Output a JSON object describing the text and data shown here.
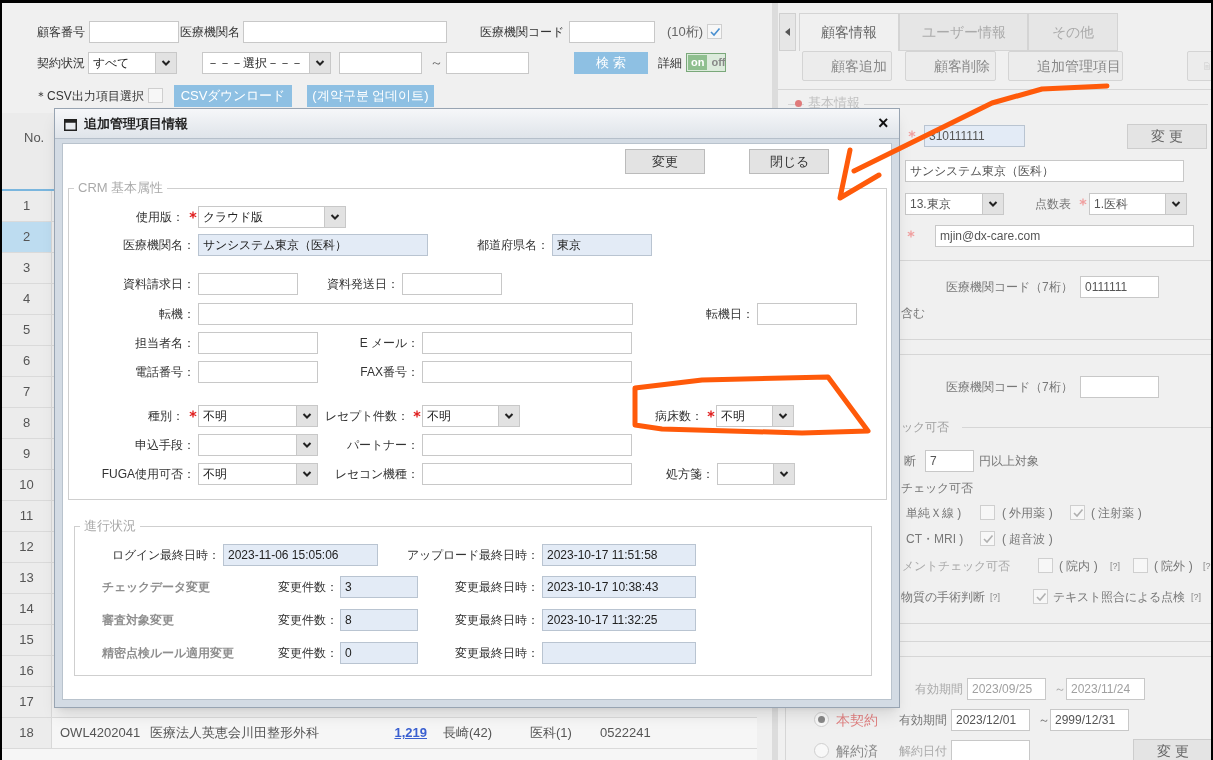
{
  "filter": {
    "rows": [
      {
        "items": [
          {
            "kind": "label",
            "text": "顧客番号"
          },
          {
            "kind": "field"
          },
          {
            "kind": "label",
            "text": "医療機関名"
          },
          {
            "kind": "field"
          },
          {
            "kind": "label",
            "text": "医療機関コード"
          },
          {
            "kind": "field"
          },
          {
            "kind": "note",
            "text": "(10桁)"
          },
          {
            "kind": "checkbox",
            "checked": true
          }
        ]
      },
      {
        "items": [
          {
            "kind": "label",
            "text": "契約状況"
          },
          {
            "kind": "select",
            "value": "すべて"
          },
          {
            "kind": "select",
            "value": "－－－選択－－－"
          },
          {
            "kind": "field"
          },
          {
            "kind": "note",
            "text": "～"
          },
          {
            "kind": "field"
          },
          {
            "kind": "primary_button",
            "text": "検 索"
          },
          {
            "kind": "label",
            "text": "詳細"
          },
          {
            "kind": "toggle",
            "on": true,
            "on_text": "on",
            "off_text": "off"
          }
        ]
      },
      {
        "items": [
          {
            "kind": "label",
            "text": "＊CSV出力項目選択"
          },
          {
            "kind": "checkbox",
            "checked": false
          },
          {
            "kind": "primary_button",
            "text": "CSVダウンロード"
          },
          {
            "kind": "primary_button",
            "text": "(계약구분 업데이트)"
          }
        ]
      }
    ]
  },
  "table": {
    "header": "No.",
    "rows": [
      {
        "no": "1",
        "selected": false
      },
      {
        "no": "2",
        "selected": true
      },
      {
        "no": "3",
        "selected": false
      },
      {
        "no": "4",
        "selected": false
      },
      {
        "no": "5",
        "selected": false
      },
      {
        "no": "6",
        "selected": false
      },
      {
        "no": "7",
        "selected": false
      },
      {
        "no": "8",
        "selected": false
      },
      {
        "no": "9",
        "selected": false
      },
      {
        "no": "10",
        "selected": false
      },
      {
        "no": "11",
        "selected": false
      },
      {
        "no": "12",
        "selected": false
      },
      {
        "no": "13",
        "selected": false
      },
      {
        "no": "14",
        "selected": false
      },
      {
        "no": "15",
        "selected": false
      },
      {
        "no": "16",
        "selected": false
      },
      {
        "no": "17",
        "selected": false
      },
      {
        "no": "18",
        "selected": false,
        "cells": [
          {
            "kind": "text",
            "text": "OWL4202041"
          },
          {
            "kind": "text",
            "text": "医療法人英恵会川田整形外科"
          },
          {
            "kind": "link",
            "text": "1,219"
          },
          {
            "kind": "text",
            "text": "長崎(42)"
          },
          {
            "kind": "text",
            "text": "医科(1)"
          },
          {
            "kind": "text",
            "text": "0522241"
          }
        ]
      }
    ]
  },
  "detail_panel": {
    "tabs": [
      {
        "label": "顧客情報",
        "selected": true
      },
      {
        "label": "ユーザー情報",
        "selected": false
      },
      {
        "label": "その他",
        "selected": false
      }
    ],
    "toolbar": [
      {
        "kind": "plus",
        "label": "顧客追加"
      },
      {
        "kind": "trash",
        "label": "顧客削除"
      },
      {
        "kind": "clipboard",
        "label": "追加管理項目"
      },
      {
        "kind": "document"
      }
    ],
    "section_title": "基本情報",
    "rows": [
      {
        "items": [
          {
            "kind": "required"
          },
          {
            "kind": "field",
            "value": "310111111",
            "readonly": true
          },
          {
            "kind": "button",
            "text": "変 更"
          }
        ]
      },
      {
        "items": [
          {
            "kind": "field",
            "value": "サンシステム東京（医科）"
          }
        ]
      },
      {
        "items": [
          {
            "kind": "select",
            "value": "13.東京"
          },
          {
            "kind": "label",
            "text": "点数表"
          },
          {
            "kind": "required"
          },
          {
            "kind": "select",
            "value": "1.医科"
          }
        ]
      },
      {
        "items": [
          {
            "kind": "required"
          },
          {
            "kind": "field",
            "value": "mjin@dx-care.com"
          }
        ]
      },
      {
        "items": [
          {
            "kind": "label",
            "text": "医療機関コード（7桁）"
          },
          {
            "kind": "field",
            "value": "0111111"
          }
        ]
      },
      {
        "items": [
          {
            "kind": "label",
            "text": "含む"
          }
        ]
      },
      {
        "items": [
          {
            "kind": "label",
            "text": "医療機関コード（7桁）"
          },
          {
            "kind": "field"
          }
        ]
      },
      {
        "items": [
          {
            "kind": "legend",
            "text": "ック可否"
          }
        ]
      },
      {
        "items": [
          {
            "kind": "label",
            "text": "断"
          },
          {
            "kind": "field",
            "value": "7"
          },
          {
            "kind": "label",
            "text": "円以上対象"
          }
        ]
      },
      {
        "items": [
          {
            "kind": "label",
            "text": "チェック可否"
          }
        ]
      },
      {
        "items": [
          {
            "kind": "label",
            "text": "単純Ｘ線 )"
          },
          {
            "kind": "checkbox",
            "checked": false
          },
          {
            "kind": "label",
            "text": "( 外用薬 )"
          },
          {
            "kind": "checkbox",
            "checked": true
          },
          {
            "kind": "label",
            "text": "( 注射薬 )"
          }
        ]
      },
      {
        "items": [
          {
            "kind": "label",
            "text": "CT・MRI )"
          },
          {
            "kind": "checkbox",
            "checked": true
          },
          {
            "kind": "label",
            "text": "( 超音波 )"
          }
        ]
      },
      {
        "items": [
          {
            "kind": "muted",
            "text": "メントチェック可否"
          },
          {
            "kind": "checkbox",
            "checked": false
          },
          {
            "kind": "label",
            "text": "( 院内 )"
          },
          {
            "kind": "help",
            "text": "[?]"
          },
          {
            "kind": "checkbox",
            "checked": false
          },
          {
            "kind": "label",
            "text": "( 院外 )"
          },
          {
            "kind": "help",
            "text": "[?"
          }
        ]
      },
      {
        "items": [
          {
            "kind": "label",
            "text": "物質の手術判断"
          },
          {
            "kind": "help",
            "text": "[?]"
          },
          {
            "kind": "checkbox",
            "checked": true
          },
          {
            "kind": "label",
            "text": "テキスト照合による点検"
          },
          {
            "kind": "help",
            "text": "[?]"
          }
        ]
      },
      {
        "items": [
          {
            "kind": "muted",
            "text": "有効期間"
          },
          {
            "kind": "field",
            "value": "2023/09/25",
            "disabled": true
          },
          {
            "kind": "muted",
            "text": "～"
          },
          {
            "kind": "field",
            "value": "2023/11/24",
            "disabled": true
          }
        ]
      },
      {
        "items": [
          {
            "kind": "radio",
            "text": "本契約",
            "selected": true
          },
          {
            "kind": "label",
            "text": "有効期間"
          },
          {
            "kind": "field",
            "value": "2023/12/01"
          },
          {
            "kind": "label",
            "text": "～"
          },
          {
            "kind": "field",
            "value": "2999/12/31"
          }
        ]
      },
      {
        "items": [
          {
            "kind": "radio",
            "text": "解約済",
            "selected": false
          },
          {
            "kind": "muted",
            "text": "解約日付"
          },
          {
            "kind": "field"
          },
          {
            "kind": "button",
            "text": "変 更"
          }
        ]
      }
    ]
  },
  "dialog": {
    "title": "追加管理項目情報",
    "close": "×",
    "buttons": [
      "変更",
      "閉じる"
    ],
    "crm": {
      "legend": "CRM 基本属性",
      "rows": [
        {
          "items": [
            {
              "kind": "label",
              "text": "使用版："
            },
            {
              "kind": "required"
            },
            {
              "kind": "select",
              "value": "クラウド版"
            }
          ]
        },
        {
          "items": [
            {
              "kind": "label",
              "text": "医療機関名："
            },
            {
              "kind": "field",
              "value": "サンシステム東京（医科）",
              "readonly": true
            },
            {
              "kind": "label",
              "text": "都道府県名："
            },
            {
              "kind": "field",
              "value": "東京",
              "readonly": true
            }
          ]
        },
        {
          "items": [
            {
              "kind": "label",
              "text": "資料請求日："
            },
            {
              "kind": "field"
            },
            {
              "kind": "label",
              "text": "資料発送日："
            },
            {
              "kind": "field"
            }
          ]
        },
        {
          "items": [
            {
              "kind": "label",
              "text": "転機："
            },
            {
              "kind": "field"
            },
            {
              "kind": "label",
              "text": "転機日："
            },
            {
              "kind": "field"
            }
          ]
        },
        {
          "items": [
            {
              "kind": "label",
              "text": "担当者名："
            },
            {
              "kind": "field"
            },
            {
              "kind": "label",
              "text": "E メール："
            },
            {
              "kind": "field"
            }
          ]
        },
        {
          "items": [
            {
              "kind": "label",
              "text": "電話番号："
            },
            {
              "kind": "field"
            },
            {
              "kind": "label",
              "text": "FAX番号："
            },
            {
              "kind": "field"
            }
          ]
        },
        {
          "items": [
            {
              "kind": "label",
              "text": "種別："
            },
            {
              "kind": "required"
            },
            {
              "kind": "select",
              "value": "不明"
            },
            {
              "kind": "label",
              "text": "レセプト件数："
            },
            {
              "kind": "required"
            },
            {
              "kind": "select",
              "value": "不明"
            },
            {
              "kind": "label",
              "text": "病床数："
            },
            {
              "kind": "required"
            },
            {
              "kind": "select",
              "value": "不明"
            }
          ]
        },
        {
          "items": [
            {
              "kind": "label",
              "text": "申込手段："
            },
            {
              "kind": "select"
            },
            {
              "kind": "label",
              "text": "パートナー："
            },
            {
              "kind": "field"
            }
          ]
        },
        {
          "items": [
            {
              "kind": "label",
              "text": "FUGA使用可否："
            },
            {
              "kind": "select",
              "value": "不明"
            },
            {
              "kind": "label",
              "text": "レセコン機種："
            },
            {
              "kind": "field"
            },
            {
              "kind": "label",
              "text": "処方箋："
            },
            {
              "kind": "select"
            }
          ]
        }
      ]
    },
    "progress": {
      "legend": "進行状況",
      "rows": [
        {
          "items": [
            {
              "kind": "label",
              "text": "ログイン最終日時："
            },
            {
              "kind": "field",
              "value": "2023-11-06 15:05:06",
              "readonly": true
            },
            {
              "kind": "label",
              "text": "アップロード最終日時："
            },
            {
              "kind": "field",
              "value": "2023-10-17 11:51:58",
              "readonly": true
            }
          ]
        },
        {
          "items": [
            {
              "kind": "heading",
              "text": "チェックデータ変更"
            },
            {
              "kind": "label",
              "text": "変更件数："
            },
            {
              "kind": "field",
              "value": "3",
              "readonly": true
            },
            {
              "kind": "label",
              "text": "変更最終日時："
            },
            {
              "kind": "field",
              "value": "2023-10-17 10:38:43",
              "readonly": true
            }
          ]
        },
        {
          "items": [
            {
              "kind": "heading",
              "text": "審査対象変更"
            },
            {
              "kind": "label",
              "text": "変更件数："
            },
            {
              "kind": "field",
              "value": "8",
              "readonly": true
            },
            {
              "kind": "label",
              "text": "変更最終日時："
            },
            {
              "kind": "field",
              "value": "2023-10-17 11:32:25",
              "readonly": true
            }
          ]
        },
        {
          "items": [
            {
              "kind": "heading",
              "text": "精密点検ルール適用変更"
            },
            {
              "kind": "label",
              "text": "変更件数："
            },
            {
              "kind": "field",
              "value": "0",
              "readonly": true
            },
            {
              "kind": "label",
              "text": "変更最終日時："
            },
            {
              "kind": "field",
              "readonly": true
            }
          ]
        }
      ]
    }
  }
}
